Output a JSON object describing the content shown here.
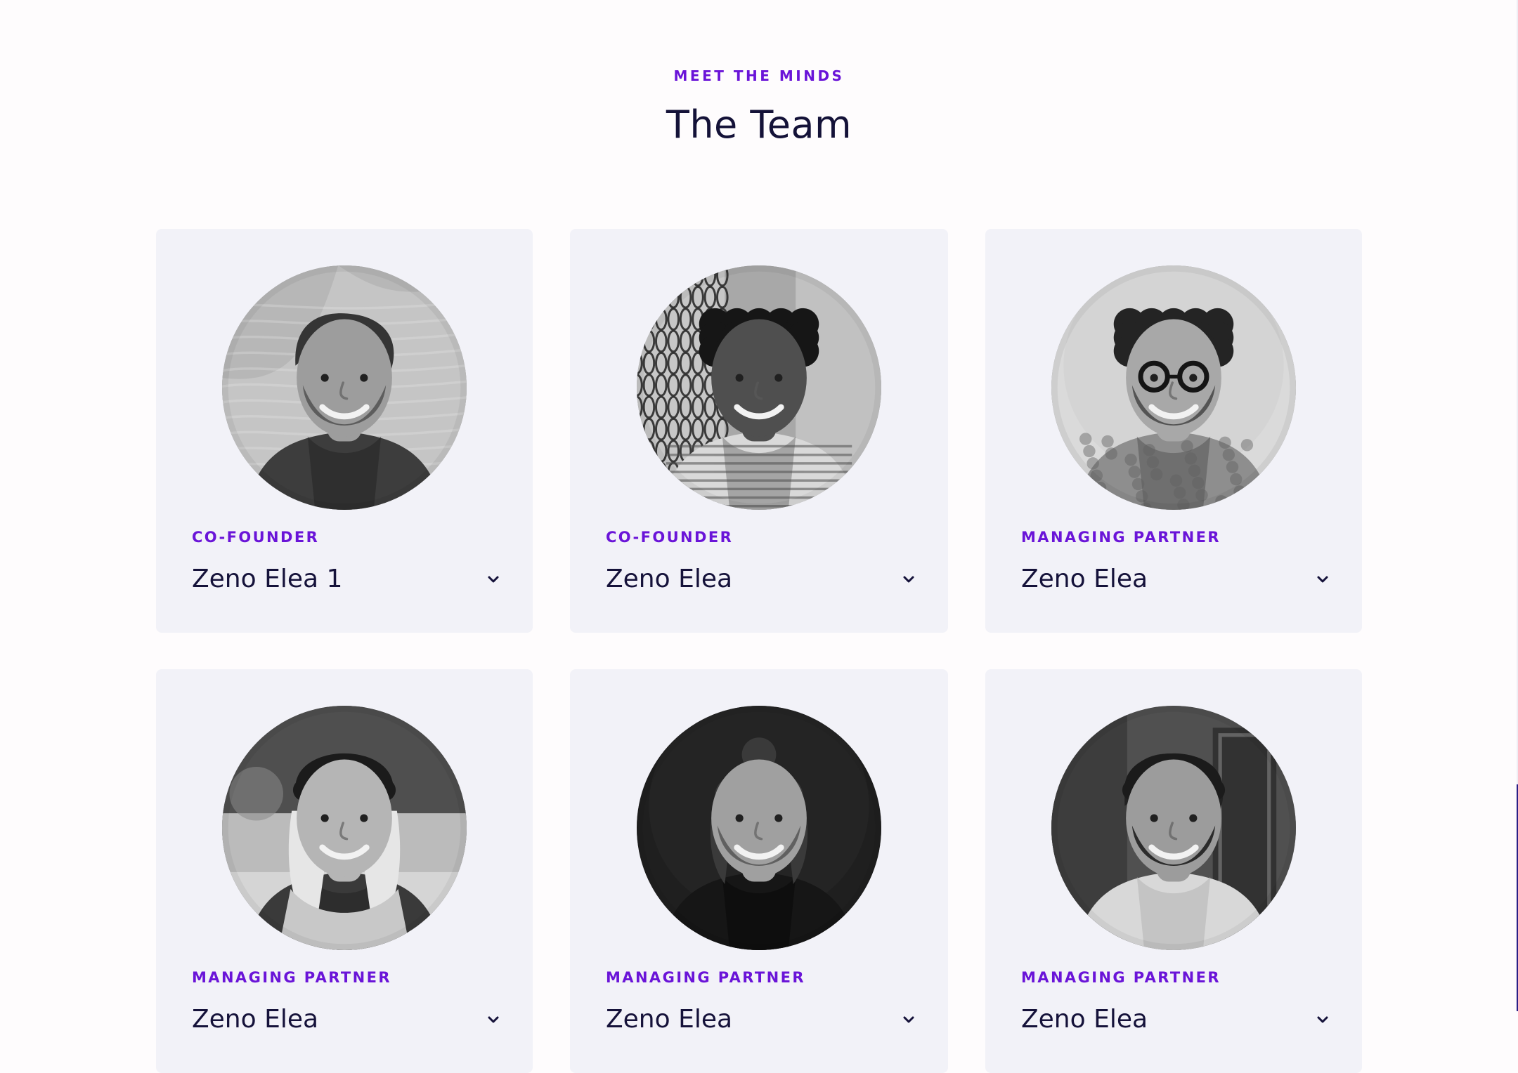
{
  "section": {
    "eyebrow": "MEET THE MINDS",
    "title": "The Team"
  },
  "team": [
    {
      "role": "CO-FOUNDER",
      "name": "Zeno Elea 1",
      "photo": {
        "bg": "#b7b7b7",
        "bg2": "#d2d2d2",
        "skin": "#9d9d9d",
        "hair": "#353535",
        "shirt": "#3d3d3d",
        "shirtDark": "#242424",
        "beard": "#5a5a5a",
        "hat": "",
        "glasses": false,
        "texture": "water",
        "hairStyle": "short"
      }
    },
    {
      "role": "CO-FOUNDER",
      "name": "Zeno Elea",
      "photo": {
        "bg": "#a8a8a8",
        "bg2": "#dadada",
        "skin": "#4f4f4f",
        "hair": "#161616",
        "shirt": "#d9d9d9",
        "shirtDark": "#7a7a7a",
        "beard": "",
        "hat": "",
        "glasses": false,
        "texture": "fence",
        "hairStyle": "curly"
      }
    },
    {
      "role": "MANAGING PARTNER",
      "name": "Zeno Elea",
      "photo": {
        "bg": "#dadada",
        "bg2": "#c9c9c9",
        "skin": "#a8a8a8",
        "hair": "#242424",
        "shirt": "#8e8e8e",
        "shirtDark": "#555555",
        "beard": "#4f4f4f",
        "hat": "",
        "glasses": true,
        "texture": "plain",
        "hairStyle": "curly"
      }
    },
    {
      "role": "MANAGING PARTNER",
      "name": "Zeno Elea",
      "photo": {
        "bg": "#777777",
        "bg2": "#c4c4c4",
        "skin": "#b5b5b5",
        "hair": "#e6e6e6",
        "shirt": "#3a3a3a",
        "shirtDark": "#222222",
        "beard": "",
        "hat": "#1b1b1b",
        "glasses": false,
        "texture": "street",
        "hairStyle": "long"
      }
    },
    {
      "role": "MANAGING PARTNER",
      "name": "Zeno Elea",
      "photo": {
        "bg": "#1f1f1f",
        "bg2": "#2d2d2d",
        "skin": "#a0a0a0",
        "hair": "#3a3a3a",
        "shirt": "#161616",
        "shirtDark": "#0a0a0a",
        "beard": "#5d5d5d",
        "hat": "",
        "glasses": false,
        "texture": "plain",
        "hairStyle": "bun"
      }
    },
    {
      "role": "MANAGING PARTNER",
      "name": "Zeno Elea",
      "photo": {
        "bg": "#505050",
        "bg2": "#707070",
        "skin": "#9c9c9c",
        "hair": "#222222",
        "shirt": "#d8d8d8",
        "shirtDark": "#b4b4b4",
        "beard": "#252525",
        "hat": "#1b1b1b",
        "glasses": false,
        "texture": "door",
        "hairStyle": "short"
      }
    }
  ]
}
